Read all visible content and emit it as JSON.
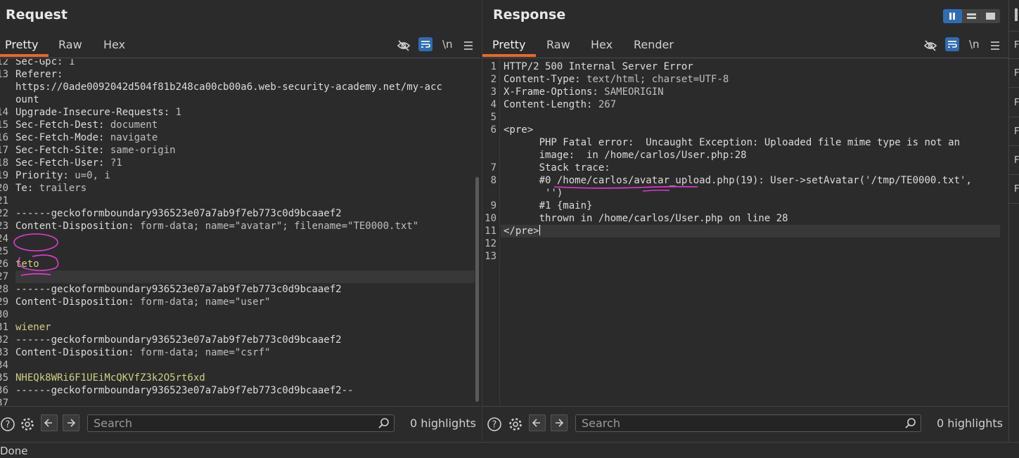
{
  "request": {
    "title": "Request",
    "tabs": [
      "Pretty",
      "Raw",
      "Hex"
    ],
    "newline_toggle": "\\n",
    "lines": [
      {
        "n": "12",
        "k": "Sec-Gpc",
        "v": "1"
      },
      {
        "n": "13",
        "k": "Referer",
        "v": ""
      },
      {
        "n": "",
        "t": "https://0ade0092042d504f81b248ca00cb00a6.web-security-academy.net/my-acc"
      },
      {
        "n": "",
        "t": "ount"
      },
      {
        "n": "14",
        "k": "Upgrade-Insecure-Requests",
        "v": "1"
      },
      {
        "n": "15",
        "k": "Sec-Fetch-Dest",
        "v": "document"
      },
      {
        "n": "16",
        "k": "Sec-Fetch-Mode",
        "v": "navigate"
      },
      {
        "n": "17",
        "k": "Sec-Fetch-Site",
        "v": "same-origin"
      },
      {
        "n": "18",
        "k": "Sec-Fetch-User",
        "v": "?1"
      },
      {
        "n": "19",
        "k": "Priority",
        "v": "u=0, i"
      },
      {
        "n": "20",
        "k": "Te",
        "v": "trailers"
      },
      {
        "n": "21",
        "t": ""
      },
      {
        "n": "22",
        "t": "------geckoformboundary936523e07a7ab9f7eb773c0d9bcaaef2"
      },
      {
        "n": "23",
        "k": "Content-Disposition",
        "v": "form-data; name=\"avatar\"; filename=\"TE0000.txt\""
      },
      {
        "n": "24",
        "t": ""
      },
      {
        "n": "25",
        "t": ""
      },
      {
        "n": "26",
        "s": "teto"
      },
      {
        "n": "27",
        "t": ""
      },
      {
        "n": "28",
        "t": "------geckoformboundary936523e07a7ab9f7eb773c0d9bcaaef2"
      },
      {
        "n": "29",
        "k": "Content-Disposition",
        "v": "form-data; name=\"user\""
      },
      {
        "n": "30",
        "t": ""
      },
      {
        "n": "31",
        "s": "wiener"
      },
      {
        "n": "32",
        "t": "------geckoformboundary936523e07a7ab9f7eb773c0d9bcaaef2"
      },
      {
        "n": "33",
        "k": "Content-Disposition",
        "v": "form-data; name=\"csrf\""
      },
      {
        "n": "34",
        "t": ""
      },
      {
        "n": "35",
        "s": "NHEQk8WRi6F1UEiMcQKVfZ3k2O5rt6xd"
      },
      {
        "n": "36",
        "t": "------geckoformboundary936523e07a7ab9f7eb773c0d9bcaaef2--"
      },
      {
        "n": "37",
        "t": ""
      }
    ],
    "search_placeholder": "Search",
    "highlights": "0 highlights"
  },
  "response": {
    "title": "Response",
    "tabs": [
      "Pretty",
      "Raw",
      "Hex",
      "Render"
    ],
    "newline_toggle": "\\n",
    "lines": [
      {
        "n": "1",
        "t": "HTTP/2 500 Internal Server Error"
      },
      {
        "n": "2",
        "k": "Content-Type",
        "v": "text/html; charset=UTF-8"
      },
      {
        "n": "3",
        "k": "X-Frame-Options",
        "v": "SAMEORIGIN"
      },
      {
        "n": "4",
        "k": "Content-Length",
        "v": "267"
      },
      {
        "n": "5",
        "t": ""
      },
      {
        "n": "6",
        "t": "<pre>"
      },
      {
        "n": "",
        "t": "      PHP Fatal error:  Uncaught Exception: Uploaded file mime type is not an"
      },
      {
        "n": "",
        "t": "      image:  in /home/carlos/User.php:28"
      },
      {
        "n": "7",
        "t": "      Stack trace:"
      },
      {
        "n": "8",
        "t": "      #0 /home/carlos/avatar_upload.php(19): User->setAvatar('/tmp/TE0000.txt',"
      },
      {
        "n": "",
        "t": "       '')"
      },
      {
        "n": "9",
        "t": "      #1 {main}"
      },
      {
        "n": "10",
        "t": "      thrown in /home/carlos/User.php on line 28"
      },
      {
        "n": "11",
        "t": "</pre>"
      },
      {
        "n": "12",
        "t": ""
      },
      {
        "n": "13",
        "t": ""
      }
    ],
    "search_placeholder": "Search",
    "highlights": "0 highlights"
  },
  "status": "Done",
  "colors": {
    "accent": "#e8672c",
    "toggle": "#2e6db5",
    "annotation": "#e23ad6"
  }
}
